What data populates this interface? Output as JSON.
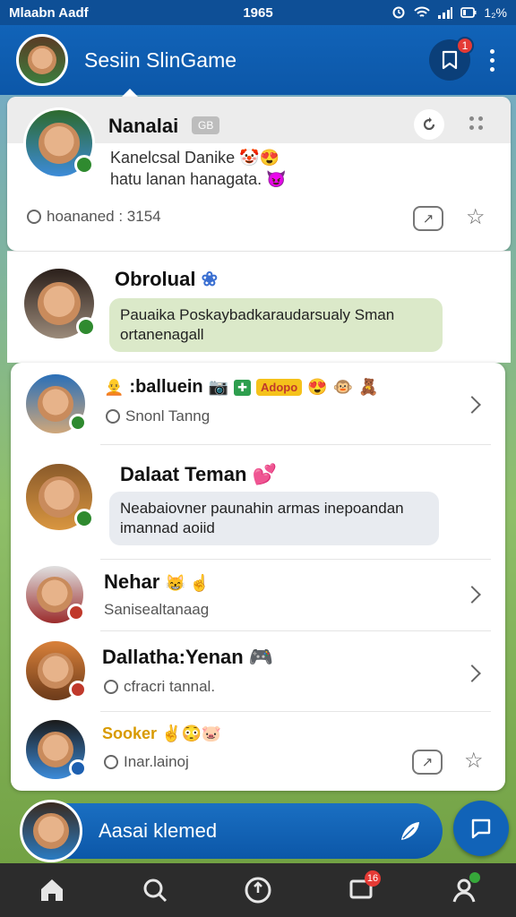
{
  "status_bar": {
    "carrier": "Mlaabn Aadf",
    "time": "1965",
    "battery": "1₂%"
  },
  "header": {
    "title": "Sesiin SlinGame",
    "notification_count": "1"
  },
  "featured": {
    "name": "Nanalai",
    "tag": "GB",
    "line1": "Kanelcsal Danike 🤡😍",
    "line2": "hatu lanan hanagata. 😈",
    "meta": "hoananed : 3154"
  },
  "group": {
    "name": "Obrolual",
    "message": "Pauaika Poskaybadkaraudarsualy Sman ortanenagall"
  },
  "list": [
    {
      "name": ":balluein",
      "prefix_emoji": "🧑‍🦲",
      "tags": [
        "📷",
        "✚",
        "Adopo",
        "😍",
        "🐵",
        "🧸"
      ],
      "sub": "Snonl Tanng"
    },
    {
      "name": "Dalaat Teman",
      "badge": "💕",
      "message": "Neabaiovner paunahin armas inepoandan imannad aoiid"
    },
    {
      "name": "Nehar",
      "emojis": "😸 ☝️",
      "sub": "Sanisealtanaag"
    },
    {
      "name": "Dallatha:Yenan",
      "badge": "🎮",
      "sub": "cfracri tannal."
    },
    {
      "name": "Sooker",
      "emojis": "✌️😳🐷",
      "sub": "Inar.lainoj"
    }
  ],
  "cta": {
    "label": "Aasai klemed"
  },
  "bottom_nav": {
    "items": [
      "home",
      "search",
      "compass",
      "messages",
      "profile"
    ],
    "messages_badge": "16"
  },
  "colors": {
    "primary": "#0c57a8",
    "status_bar": "#0e4f96",
    "bubble_green": "#dbe9c9",
    "bubble_gray": "#e8ebf0",
    "badge_red": "#e53a35",
    "online_green": "#2f8a2f",
    "nav_bg": "#2c2c2c"
  }
}
